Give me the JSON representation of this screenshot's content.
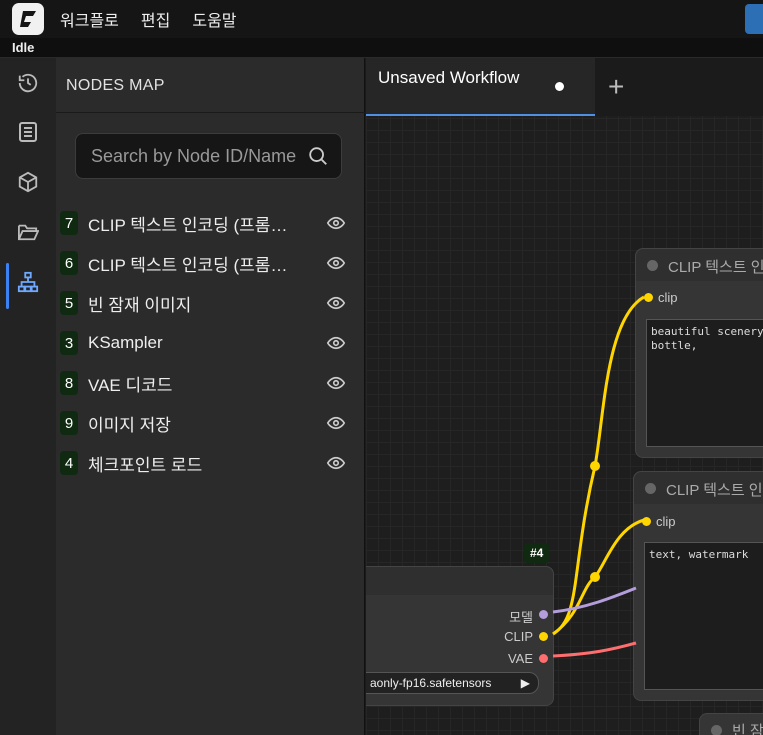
{
  "menu": {
    "items": [
      "워크플로",
      "편집",
      "도움말"
    ]
  },
  "status": "Idle",
  "panel": {
    "title": "NODES MAP",
    "search_placeholder": "Search by Node ID/Name",
    "nodes": [
      {
        "id": "7",
        "label": "CLIP 텍스트 인코딩 (프롬프트)"
      },
      {
        "id": "6",
        "label": "CLIP 텍스트 인코딩 (프롬프트)"
      },
      {
        "id": "5",
        "label": "빈 잠재 이미지"
      },
      {
        "id": "3",
        "label": "KSampler"
      },
      {
        "id": "8",
        "label": "VAE 디코드"
      },
      {
        "id": "9",
        "label": "이미지 저장"
      },
      {
        "id": "4",
        "label": "체크포인트 로드"
      }
    ]
  },
  "tabs": {
    "active": "Unsaved Workflow",
    "add": "+"
  },
  "canvas": {
    "clip_node_top": {
      "title": "CLIP 텍스트 인코딩",
      "input": "clip",
      "text": "beautiful scenery\nbottle,"
    },
    "clip_node_bottom": {
      "title": "CLIP 텍스트 인코딩",
      "input": "clip",
      "text": "text, watermark"
    },
    "checkpoint_node": {
      "badge": "#4",
      "outputs": [
        "모델",
        "CLIP",
        "VAE"
      ],
      "ckpt_value": "aonly-fp16.safetensors"
    },
    "partial_node": {
      "title": "빈 잠재"
    }
  },
  "colors": {
    "clip": "#ffd500",
    "model": "#b39ddb",
    "vae": "#ff6e6e",
    "accent": "#3b82f6"
  }
}
